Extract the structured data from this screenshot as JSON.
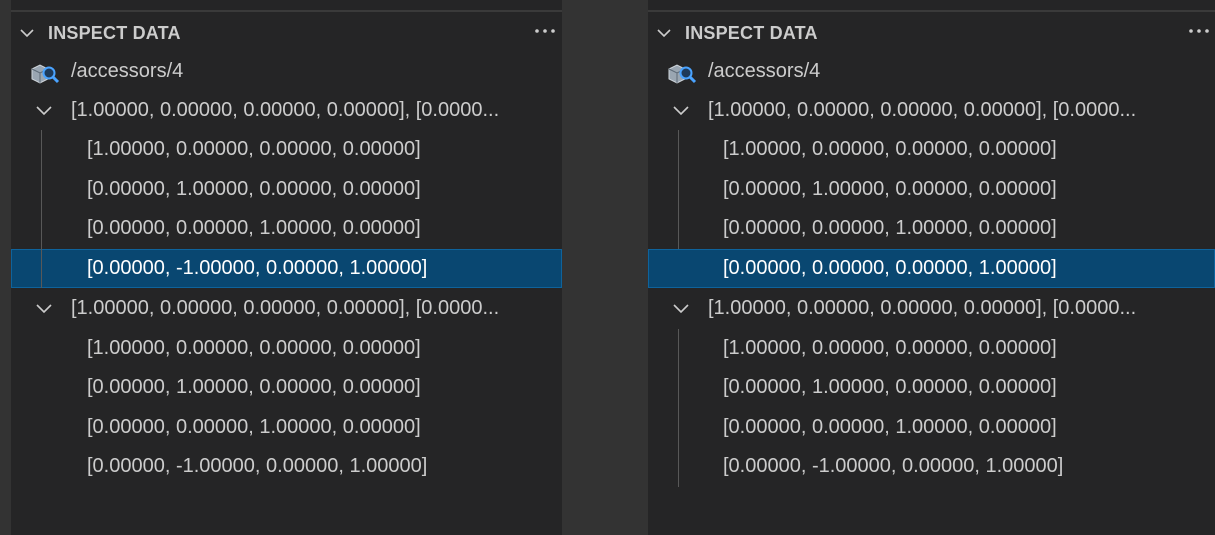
{
  "panels": [
    {
      "header": {
        "title": "INSPECT DATA",
        "more_icon": "ellipsis-icon"
      },
      "root": {
        "icon": "inspect-data-icon",
        "label": "/accessors/4"
      },
      "groups": [
        {
          "label": "[1.00000, 0.00000, 0.00000, 0.00000], [0.0000...",
          "rows": [
            "[1.00000, 0.00000, 0.00000, 0.00000]",
            "[0.00000, 1.00000, 0.00000, 0.00000]",
            "[0.00000, 0.00000, 1.00000, 0.00000]",
            "[0.00000, -1.00000, 0.00000, 1.00000]"
          ]
        },
        {
          "label": "[1.00000, 0.00000, 0.00000, 0.00000], [0.0000...",
          "rows": [
            "[1.00000, 0.00000, 0.00000, 0.00000]",
            "[0.00000, 1.00000, 0.00000, 0.00000]",
            "[0.00000, 0.00000, 1.00000, 0.00000]",
            "[0.00000, -1.00000, 0.00000, 1.00000]"
          ]
        }
      ],
      "selected": "group1-row4"
    },
    {
      "header": {
        "title": "INSPECT DATA",
        "more_icon": "ellipsis-icon"
      },
      "root": {
        "icon": "inspect-data-icon",
        "label": "/accessors/4"
      },
      "groups": [
        {
          "label": "[1.00000, 0.00000, 0.00000, 0.00000], [0.0000...",
          "rows": [
            "[1.00000, 0.00000, 0.00000, 0.00000]",
            "[0.00000, 1.00000, 0.00000, 0.00000]",
            "[0.00000, 0.00000, 1.00000, 0.00000]",
            "[0.00000, 0.00000, 0.00000, 1.00000]"
          ]
        },
        {
          "label": "[1.00000, 0.00000, 0.00000, 0.00000], [0.0000...",
          "rows": [
            "[1.00000, 0.00000, 0.00000, 0.00000]",
            "[0.00000, 1.00000, 0.00000, 0.00000]",
            "[0.00000, 0.00000, 1.00000, 0.00000]",
            "[0.00000, -1.00000, 0.00000, 1.00000]"
          ]
        }
      ],
      "selected": "group1-row4"
    }
  ],
  "colors": {
    "panel_bg": "#252526",
    "divider_bg": "#333333",
    "selection_bg": "#094771",
    "selection_border": "#0e639c",
    "text": "#cccccc"
  }
}
